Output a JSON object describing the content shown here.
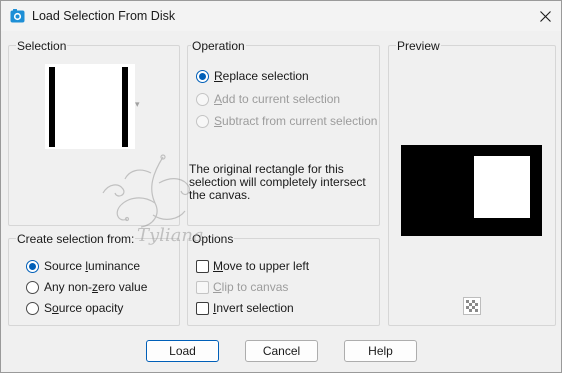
{
  "window": {
    "title": "Load Selection From Disk",
    "close_glyph": "✕"
  },
  "selection_group": {
    "label": "Selection",
    "dropdown_arrow": "▾"
  },
  "operation_group": {
    "label": "Operation",
    "options": [
      {
        "label": "Replace selection",
        "accel": "R",
        "rest": "eplace selection",
        "checked": true,
        "disabled": false
      },
      {
        "label": "Add to current selection",
        "accel": "A",
        "rest": "dd to current selection",
        "checked": false,
        "disabled": true
      },
      {
        "label": "Subtract from current selection",
        "accel": "S",
        "rest": "ubtract from current selection",
        "checked": false,
        "disabled": true
      }
    ],
    "info": "The original rectangle for this selection will completely intersect the canvas."
  },
  "preview_group": {
    "label": "Preview",
    "checker_icon": "checkerboard-icon"
  },
  "create_from_group": {
    "label": "Create selection from:",
    "options": [
      {
        "label": "Source luminance",
        "pre": "Source ",
        "accel": "l",
        "rest": "uminance",
        "checked": true
      },
      {
        "label": "Any non-zero value",
        "pre": "Any non-",
        "accel": "z",
        "rest": "ero value",
        "checked": false
      },
      {
        "label": "Source opacity",
        "pre": "S",
        "accel": "o",
        "rest": "urce opacity",
        "checked": false
      }
    ]
  },
  "options_group": {
    "label": "Options",
    "items": [
      {
        "label": "Move to upper left",
        "accel": "M",
        "rest": "ove to upper left",
        "checked": false,
        "disabled": false
      },
      {
        "label": "Clip to canvas",
        "accel": "C",
        "rest": "lip to canvas",
        "checked": false,
        "disabled": true
      },
      {
        "label": "Invert selection",
        "accel": "I",
        "rest": "nvert selection",
        "checked": false,
        "disabled": false
      }
    ]
  },
  "buttons": {
    "load": "Load",
    "cancel": "Cancel",
    "help": "Help"
  },
  "watermark": {
    "text": "Tyliana"
  },
  "colors": {
    "accent": "#005fb8",
    "background": "#f0f0f0",
    "preview_black": "#000000",
    "preview_white": "#ffffff"
  }
}
